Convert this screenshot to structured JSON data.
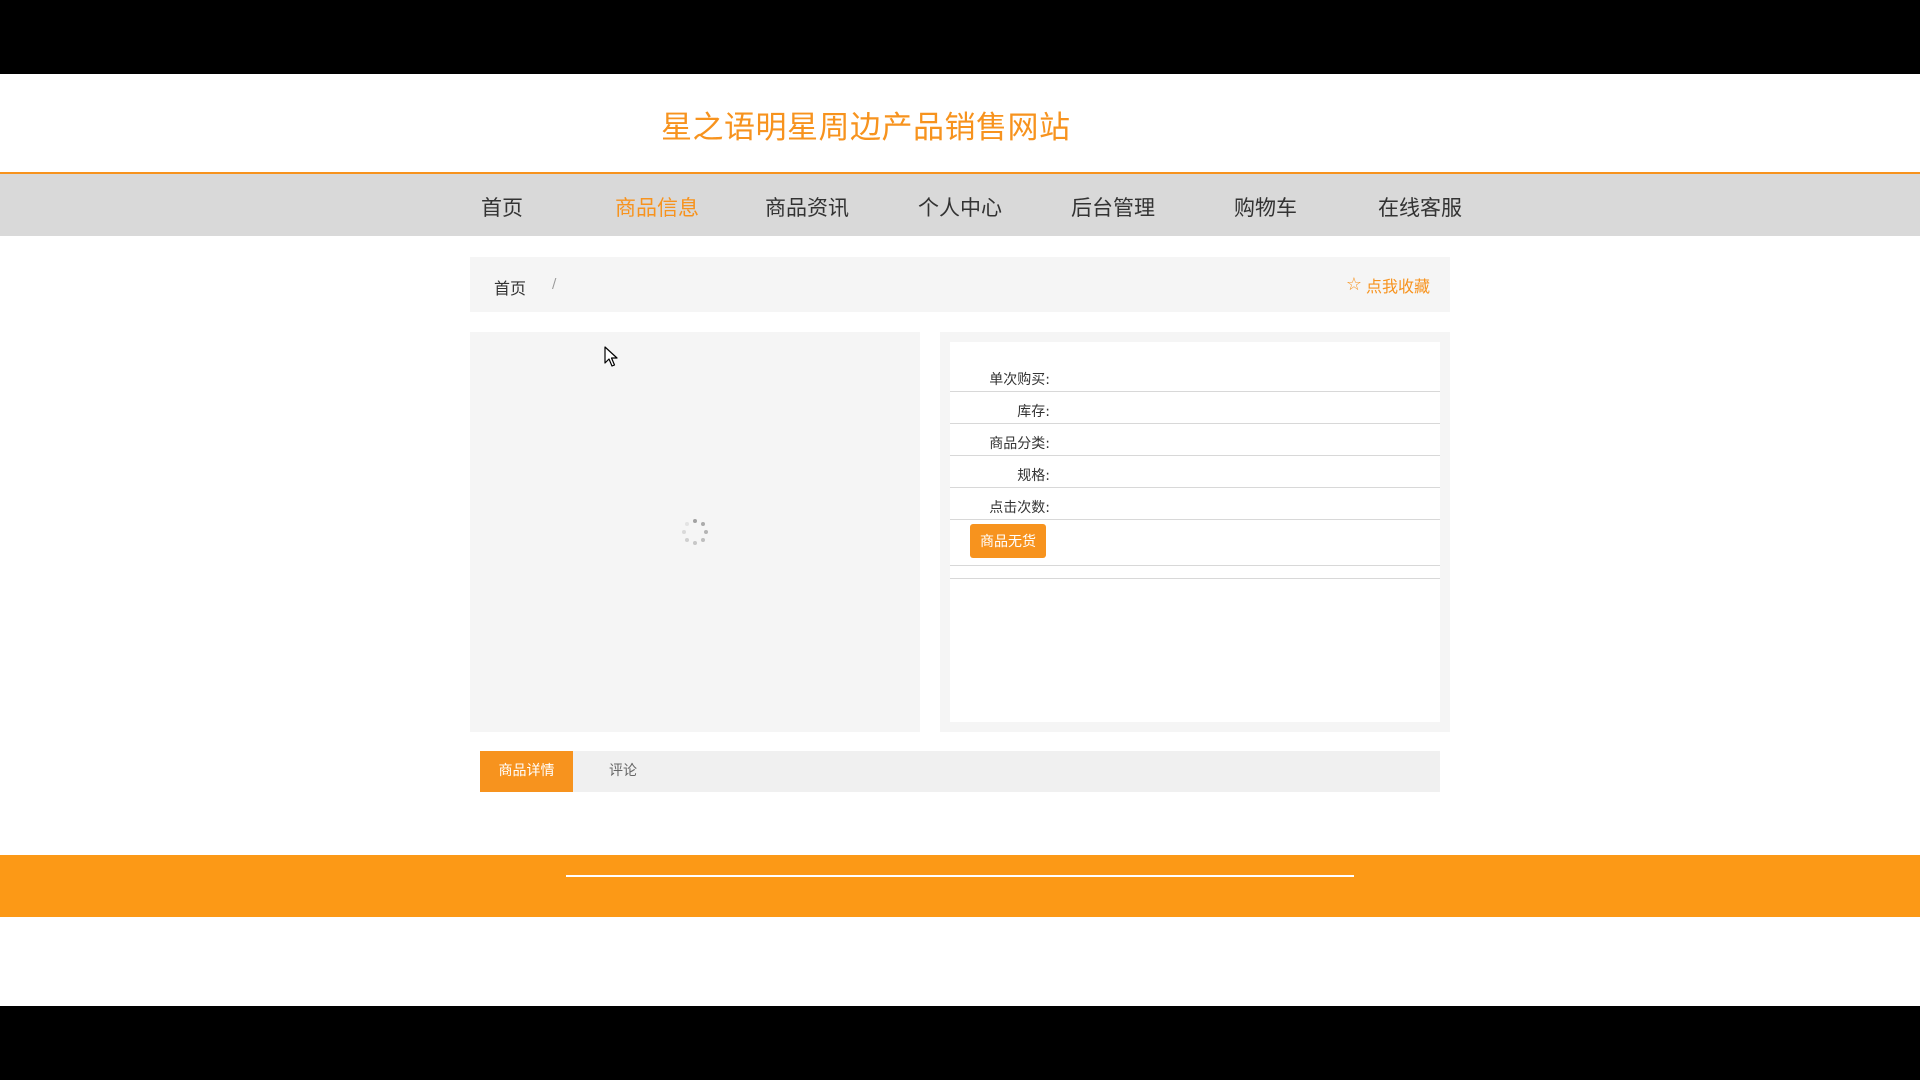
{
  "site": {
    "title": "星之语明星周边产品销售网站"
  },
  "nav": {
    "items": [
      {
        "label": "首页"
      },
      {
        "label": "商品信息"
      },
      {
        "label": "商品资讯"
      },
      {
        "label": "个人中心"
      },
      {
        "label": "后台管理"
      },
      {
        "label": "购物车"
      },
      {
        "label": "在线客服"
      }
    ],
    "active": "商品信息"
  },
  "breadcrumb": {
    "home": "首页",
    "separator": "/",
    "favorite_label": "点我收藏",
    "favorite_icon": "star-outline-icon"
  },
  "product_info": {
    "labels": {
      "single_purchase": "单次购买:",
      "stock": "库存:",
      "category": "商品分类:",
      "spec": "规格:",
      "clicks": "点击次数:"
    },
    "out_of_stock_button": "商品无货"
  },
  "tabs": {
    "details": "商品详情",
    "comments": "评论"
  },
  "colors": {
    "accent": "#f7931e",
    "footer": "#fc9916",
    "nav_bg": "#d9d9d9",
    "panel_bg": "#f5f5f5"
  }
}
